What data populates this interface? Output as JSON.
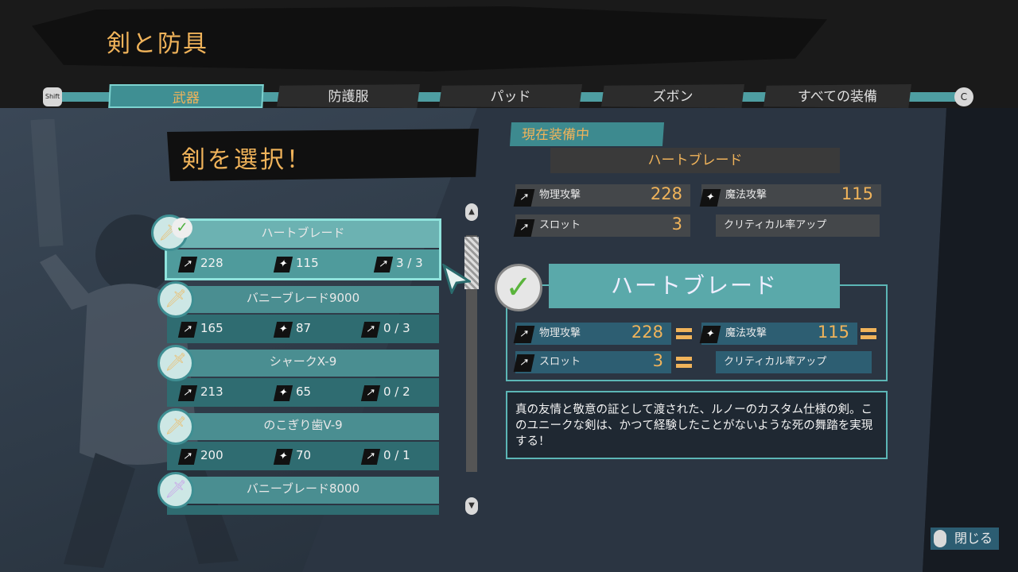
{
  "page_title": "剣と防具",
  "tab_keys": {
    "left": "Shift",
    "right": "C"
  },
  "tabs": [
    {
      "label": "武器",
      "active": true
    },
    {
      "label": "防護服",
      "active": false
    },
    {
      "label": "パッド",
      "active": false
    },
    {
      "label": "ズボン",
      "active": false
    },
    {
      "label": "すべての装備",
      "active": false
    }
  ],
  "select_prompt": "剣を選択！",
  "weapons": [
    {
      "name": "ハートブレード",
      "physical": "228",
      "magic": "115",
      "slots": "3 / 3",
      "equipped": true,
      "selected": true,
      "icon_color": "#e8c27a"
    },
    {
      "name": "バニーブレード9000",
      "physical": "165",
      "magic": "87",
      "slots": "0 / 3",
      "equipped": false,
      "selected": false,
      "icon_color": "#e8c27a"
    },
    {
      "name": "シャークX-9",
      "physical": "213",
      "magic": "65",
      "slots": "0 / 2",
      "equipped": false,
      "selected": false,
      "icon_color": "#e8c27a"
    },
    {
      "name": "のこぎり歯V-9",
      "physical": "200",
      "magic": "70",
      "slots": "0 / 1",
      "equipped": false,
      "selected": false,
      "icon_color": "#e8c27a"
    },
    {
      "name": "バニーブレード8000",
      "physical": "",
      "magic": "",
      "slots": "",
      "equipped": false,
      "selected": false,
      "icon_color": "#c9a8e8"
    }
  ],
  "current": {
    "tag": "現在装備中",
    "name": "ハートブレード",
    "physical_label": "物理攻撃",
    "physical": "228",
    "magic_label": "魔法攻撃",
    "magic": "115",
    "slot_label": "スロット",
    "slots": "3",
    "perk": "クリティカル率アップ"
  },
  "compare": {
    "name": "ハートブレード",
    "physical_label": "物理攻撃",
    "physical": "228",
    "magic_label": "魔法攻撃",
    "magic": "115",
    "slot_label": "スロット",
    "slots": "3",
    "perk": "クリティカル率アップ"
  },
  "description": "真の友情と敬意の証として渡された、ルノーのカスタム仕様の剣。このユニークな剣は、かつて経験したことがないような死の舞踏を実現する！",
  "close_label": "閉じる",
  "colors": {
    "accent": "#f0b35a",
    "teal": "#4e9ea2",
    "header": "#1a1a1a"
  }
}
